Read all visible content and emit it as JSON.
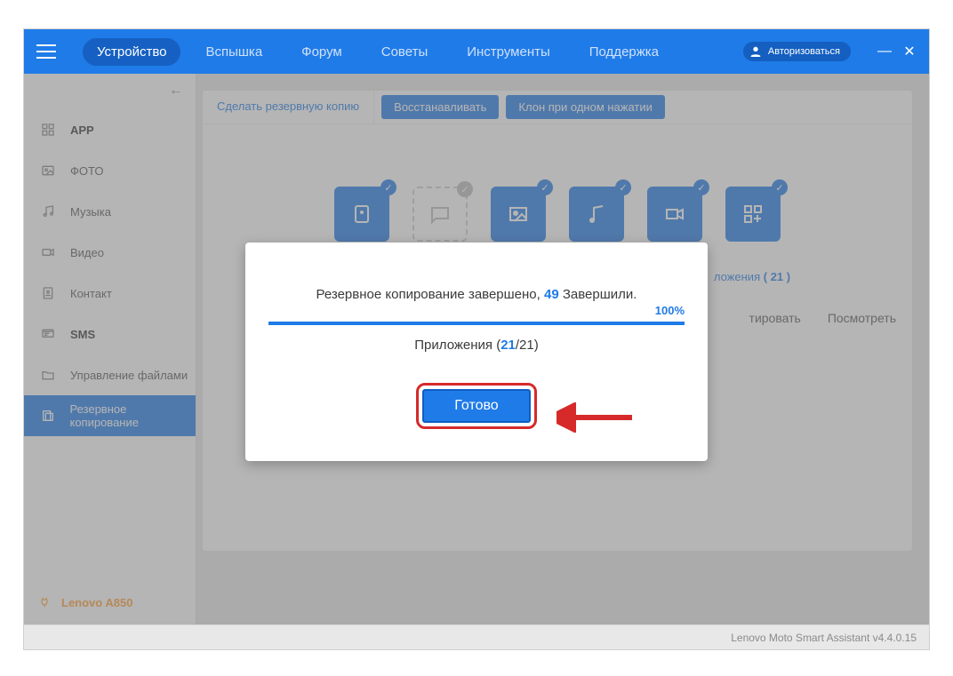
{
  "header": {
    "nav": [
      "Устройство",
      "Вспышка",
      "Форум",
      "Советы",
      "Инструменты",
      "Поддержка"
    ],
    "active_nav_index": 0,
    "login_label": "Авторизоваться"
  },
  "sidebar": {
    "items": [
      {
        "label": "APP",
        "bold": true,
        "icon": "grid"
      },
      {
        "label": "ФОТО",
        "bold": false,
        "icon": "photo"
      },
      {
        "label": "Музыка",
        "bold": false,
        "icon": "music"
      },
      {
        "label": "Видео",
        "bold": false,
        "icon": "video"
      },
      {
        "label": "Контакт",
        "bold": false,
        "icon": "contact"
      },
      {
        "label": "SMS",
        "bold": true,
        "icon": "sms"
      },
      {
        "label": "Управление файлами",
        "bold": false,
        "icon": "folder"
      },
      {
        "label": "Резервное копирование",
        "bold": false,
        "icon": "backup",
        "active": true
      }
    ],
    "device_name": "Lenovo A850"
  },
  "main": {
    "tabs": {
      "primary": "Сделать резервную копию",
      "secondary": [
        "Восстанавливать",
        "Клон при одном нажатии"
      ]
    },
    "tiles": [
      {
        "icon": "contacts",
        "enabled": true
      },
      {
        "icon": "sms",
        "enabled": false
      },
      {
        "icon": "photo",
        "enabled": true
      },
      {
        "icon": "music",
        "enabled": true
      },
      {
        "icon": "video",
        "enabled": true
      },
      {
        "icon": "apps",
        "enabled": true,
        "label_prefix": "ложения",
        "count": "( 21 )"
      }
    ],
    "action_links": [
      "тировать",
      "Посмотреть"
    ],
    "backup_button": "Сделать резервную копию"
  },
  "modal": {
    "line_before": "Резервное копирование завершено, ",
    "completed_count": "49",
    "line_after": " Завершили.",
    "percent": "100%",
    "sub_before": "Приложения (",
    "sub_progress_done": "21",
    "sub_progress_sep": "/21)",
    "done_label": "Готово"
  },
  "statusbar": {
    "text": "Lenovo Moto Smart Assistant v4.4.0.15"
  }
}
